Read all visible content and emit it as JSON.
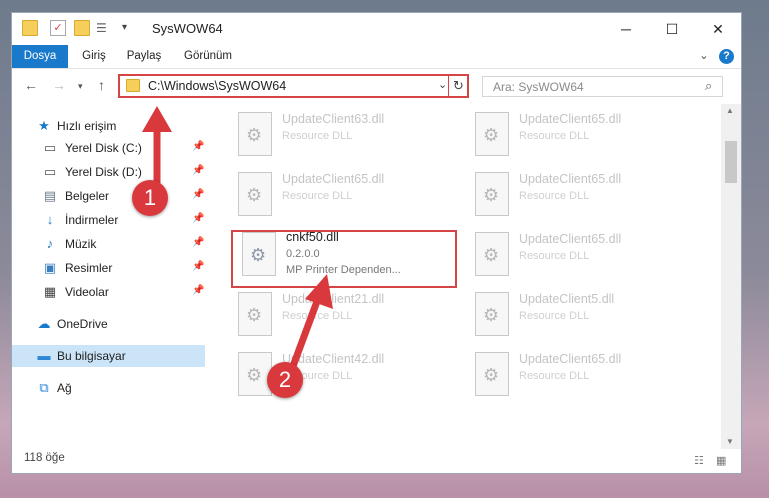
{
  "window": {
    "title": "SysWOW64",
    "controls": {
      "minimize": "─",
      "maximize": "☐",
      "close": "✕"
    }
  },
  "ribbon": {
    "tabs": [
      "Dosya",
      "Giriş",
      "Paylaş",
      "Görünüm"
    ],
    "expand": "⌄",
    "help": "?"
  },
  "address": {
    "path": "C:\\Windows\\SysWOW64",
    "search_placeholder": "Ara: SysWOW64"
  },
  "sidebar": {
    "quick_access": "Hızlı erişim",
    "items": [
      "Yerel Disk (C:)",
      "Yerel Disk (D:)",
      "Belgeler",
      "İndirmeler",
      "Müzik",
      "Resimler",
      "Videolar"
    ],
    "onedrive": "OneDrive",
    "this_pc": "Bu bilgisayar",
    "network": "Ağ"
  },
  "files": {
    "left": [
      {
        "name": "UpdateClient63.dll",
        "desc": "Resource DLL"
      },
      {
        "name": "UpdateClient65.dll",
        "desc": "Resource DLL"
      },
      {
        "name": "cnkf50.dll",
        "version": "0.2.0.0",
        "desc": "MP Printer Dependen..."
      },
      {
        "name": "UpdateClient21.dll",
        "desc": "Resource DLL"
      },
      {
        "name": "UpdateClient42.dll",
        "desc": "Resource DLL"
      }
    ],
    "right": [
      {
        "name": "UpdateClient65.dll",
        "desc": "Resource DLL"
      },
      {
        "name": "UpdateClient65.dll",
        "desc": "Resource DLL"
      },
      {
        "name": "UpdateClient65.dll",
        "desc": "Resource DLL"
      },
      {
        "name": "UpdateClient5.dll",
        "desc": "Resource DLL"
      },
      {
        "name": "UpdateClient65.dll",
        "desc": "Resource DLL"
      }
    ]
  },
  "status": {
    "count": "118 öğe"
  },
  "markers": {
    "one": "1",
    "two": "2"
  },
  "colors": {
    "accent": "#1979ca",
    "highlight": "#d64545"
  }
}
